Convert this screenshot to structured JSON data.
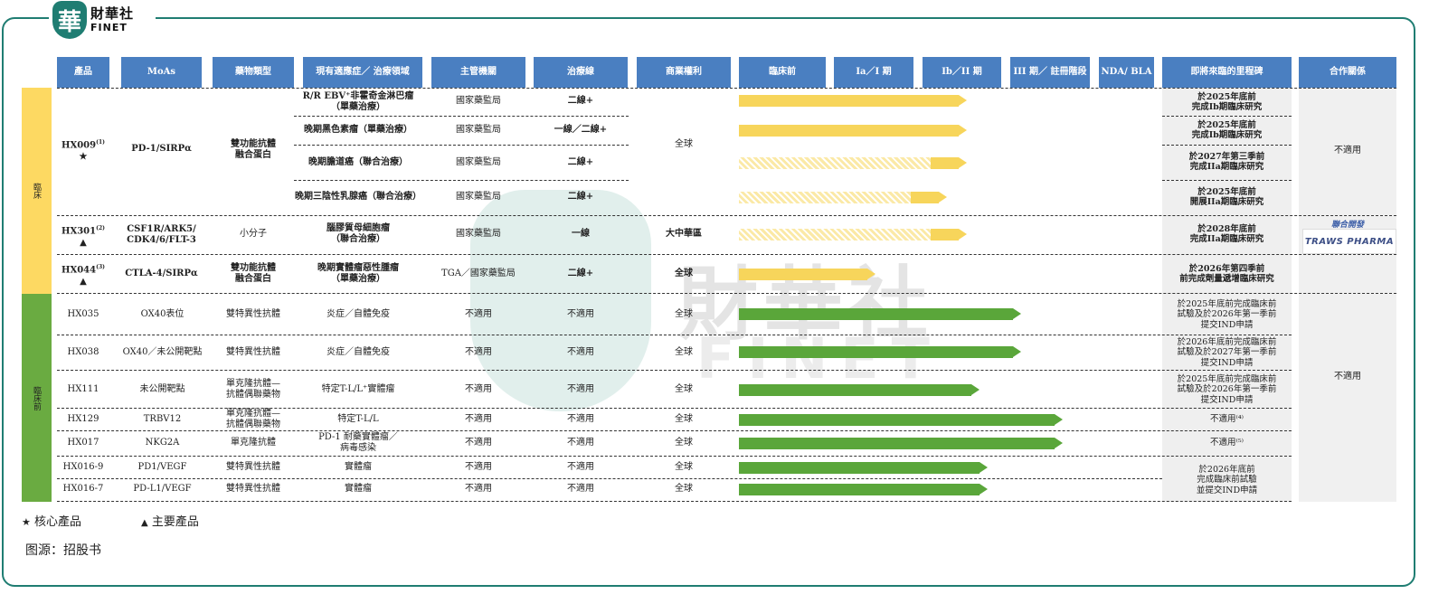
{
  "brand": {
    "seal_char": "華",
    "name_cn": "財華社",
    "name_en": "FINET"
  },
  "watermark": {
    "cn": "財華社",
    "en": "FINET"
  },
  "headers": [
    "產品",
    "MoAs",
    "藥物類型",
    "現有適應症／\n治療領域",
    "主管機關",
    "治療線",
    "商業權利",
    "臨床前",
    "Ia／I 期",
    "Ib／II 期",
    "III 期／\n註冊階段",
    "NDA/\nBLA",
    "即將來臨的里程碑",
    "合作關係"
  ],
  "stages": {
    "clinical": "臨床",
    "preclinical": "臨床前",
    "clinical_color": "#fdd962",
    "preclinical_color": "#6aab41"
  },
  "hx009": {
    "product": "HX009",
    "note": "(1)",
    "marker": "★",
    "moa": "PD-1/SIRPα",
    "type": "雙功能抗體\n融合蛋白",
    "rights": "全球",
    "partner": "不適用",
    "rows": [
      {
        "indication": "R/R EBV⁺非霍奇金淋巴瘤\n（單藥治療）",
        "regulator": "國家藥監局",
        "line": "二線+",
        "milestone": "於2025年底前\n完成Ib期臨床研究"
      },
      {
        "indication": "晚期黑色素瘤（單藥治療）",
        "regulator": "國家藥監局",
        "line": "一線／二線+",
        "milestone": "於2025年底前\n完成Ib期臨床研究"
      },
      {
        "indication": "晚期膽道癌（聯合治療）",
        "regulator": "國家藥監局",
        "line": "二線+",
        "milestone": "於2027年第三季前\n完成IIa期臨床研究"
      },
      {
        "indication": "晚期三陰性乳腺癌（聯合治療）",
        "regulator": "國家藥監局",
        "line": "二線+",
        "milestone": "於2025年底前\n開展IIa期臨床研究"
      }
    ]
  },
  "hx301": {
    "product": "HX301",
    "note": "(2)",
    "marker": "▲",
    "moa": "CSF1R/ARK5/\nCDK4/6/FLT-3",
    "type": "小分子",
    "indication": "腦膠質母細胞瘤\n（聯合治療）",
    "regulator": "國家藥監局",
    "line": "一線",
    "rights": "大中華區",
    "milestone": "於2028年底前\n完成IIa期臨床研究",
    "partner_tag": "聯合開發",
    "partner_logo": "TRAWS PHARMA"
  },
  "hx044": {
    "product": "HX044",
    "note": "(3)",
    "marker": "▲",
    "moa": "CTLA-4/SIRPα",
    "type": "雙功能抗體\n融合蛋白",
    "indication": "晚期實體瘤惡性腫瘤\n（單藥治療）",
    "regulator": "TGA／國家藥監局",
    "line": "二線+",
    "rights": "全球",
    "milestone": "於2026年第四季前\n前完成劑量遞增臨床研究"
  },
  "preclinical": [
    {
      "product": "HX035",
      "moa": "OX40表位",
      "type": "雙特異性抗體",
      "indication": "炎症／自體免疫",
      "regulator": "不適用",
      "line": "不適用",
      "rights": "全球",
      "milestone": "於2025年底前完成臨床前\n試驗及於2026年第一季前\n提交IND申請"
    },
    {
      "product": "HX038",
      "moa": "OX40／未公開靶點",
      "type": "雙特異性抗體",
      "indication": "炎症／自體免疫",
      "regulator": "不適用",
      "line": "不適用",
      "rights": "全球",
      "milestone": "於2026年底前完成臨床前\n試驗及於2027年第一季前\n提交IND申請"
    },
    {
      "product": "HX111",
      "moa": "未公開靶點",
      "type": "單克隆抗體—\n抗體偶聯藥物",
      "indication": "特定T-L/L⁺實體瘤",
      "regulator": "不適用",
      "line": "不適用",
      "rights": "全球",
      "milestone": "於2025年底前完成臨床前\n試驗及於2026年第一季前\n提交IND申請"
    },
    {
      "product": "HX129",
      "moa": "TRBV12",
      "type": "單克隆抗體—\n抗體偶聯藥物",
      "indication": "特定T-L/L",
      "regulator": "不適用",
      "line": "不適用",
      "rights": "全球",
      "milestone": "不適用⁽⁴⁾"
    },
    {
      "product": "HX017",
      "moa": "NKG2A",
      "type": "單克隆抗體",
      "indication": "PD-1 耐藥實體瘤／\n病毒感染",
      "regulator": "不適用",
      "line": "不適用",
      "rights": "全球",
      "milestone": "不適用⁽⁵⁾"
    },
    {
      "product": "HX016-9",
      "moa": "PD1/VEGF",
      "type": "雙特異性抗體",
      "indication": "實體瘤",
      "regulator": "不適用",
      "line": "不適用",
      "rights": "全球"
    },
    {
      "product": "HX016-7",
      "moa": "PD-L1/VEGF",
      "type": "雙特異性抗體",
      "indication": "實體瘤",
      "regulator": "不適用",
      "line": "不適用",
      "rights": "全球"
    }
  ],
  "hx016_milestone": "於2026年底前\n完成臨床前試驗\n並提交IND申請",
  "preclinical_partner": "不適用",
  "progress": [
    {
      "stage": "clinical",
      "extent": 0.55,
      "color": "yellow",
      "hatched": false
    },
    {
      "stage": "clinical",
      "extent": 0.55,
      "color": "yellow",
      "hatched": false
    },
    {
      "stage": "clinical",
      "extent": 0.55,
      "color": "yellow",
      "hatched": true
    },
    {
      "stage": "clinical",
      "extent": 0.5,
      "color": "yellow",
      "hatched": true
    },
    {
      "stage": "clinical",
      "extent": 0.55,
      "color": "yellow",
      "hatched": true
    },
    {
      "stage": "clinical",
      "extent": 0.33,
      "color": "yellow",
      "hatched": false
    },
    {
      "stage": "preclinical",
      "extent": 0.68,
      "color": "green",
      "hatched": false
    },
    {
      "stage": "preclinical",
      "extent": 0.68,
      "color": "green",
      "hatched": false
    },
    {
      "stage": "preclinical",
      "extent": 0.58,
      "color": "green",
      "hatched": false
    },
    {
      "stage": "preclinical",
      "extent": 0.78,
      "color": "green",
      "hatched": false
    },
    {
      "stage": "preclinical",
      "extent": 0.78,
      "color": "green",
      "hatched": false
    },
    {
      "stage": "preclinical",
      "extent": 0.6,
      "color": "green",
      "hatched": false
    },
    {
      "stage": "preclinical",
      "extent": 0.6,
      "color": "green",
      "hatched": false
    }
  ],
  "legend": {
    "star": "★",
    "star_label": "核心產品",
    "tri": "▲",
    "tri_label": "主要產品"
  },
  "source": "图源：招股书"
}
